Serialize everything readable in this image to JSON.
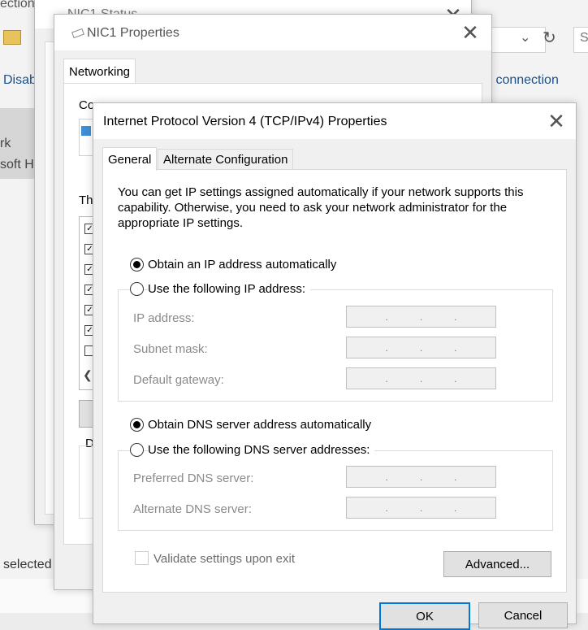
{
  "background": {
    "top_text": "ection",
    "disable_text": "Disab",
    "connection_text": "s connection",
    "network_line1": "rk",
    "network_line2": "soft H",
    "selected_text": "selected"
  },
  "nic_status": {
    "title": "NIC1 Status"
  },
  "nic_properties": {
    "title": "NIC1 Properties",
    "tab": "Networking",
    "connect_using_partial": "Co",
    "this_connection_partial": "Th",
    "description_partial": "D"
  },
  "ipv4_dialog": {
    "title": "Internet Protocol Version 4 (TCP/IPv4) Properties",
    "tabs": [
      "General",
      "Alternate Configuration"
    ],
    "description": "You can get IP settings assigned automatically if your network supports this capability. Otherwise, you need to ask your network administrator for the appropriate IP settings.",
    "obtain_ip_auto": "Obtain an IP address automatically",
    "use_following_ip": "Use the following IP address:",
    "ip_address_label": "IP address:",
    "subnet_mask_label": "Subnet mask:",
    "default_gateway_label": "Default gateway:",
    "obtain_dns_auto": "Obtain DNS server address automatically",
    "use_following_dns": "Use the following DNS server addresses:",
    "preferred_dns_label": "Preferred DNS server:",
    "alternate_dns_label": "Alternate DNS server:",
    "validate_label": "Validate settings upon exit",
    "advanced_button": "Advanced...",
    "ok_button": "OK",
    "cancel_button": "Cancel",
    "ip_mode": "automatic",
    "dns_mode": "automatic",
    "validate_checked": false
  }
}
